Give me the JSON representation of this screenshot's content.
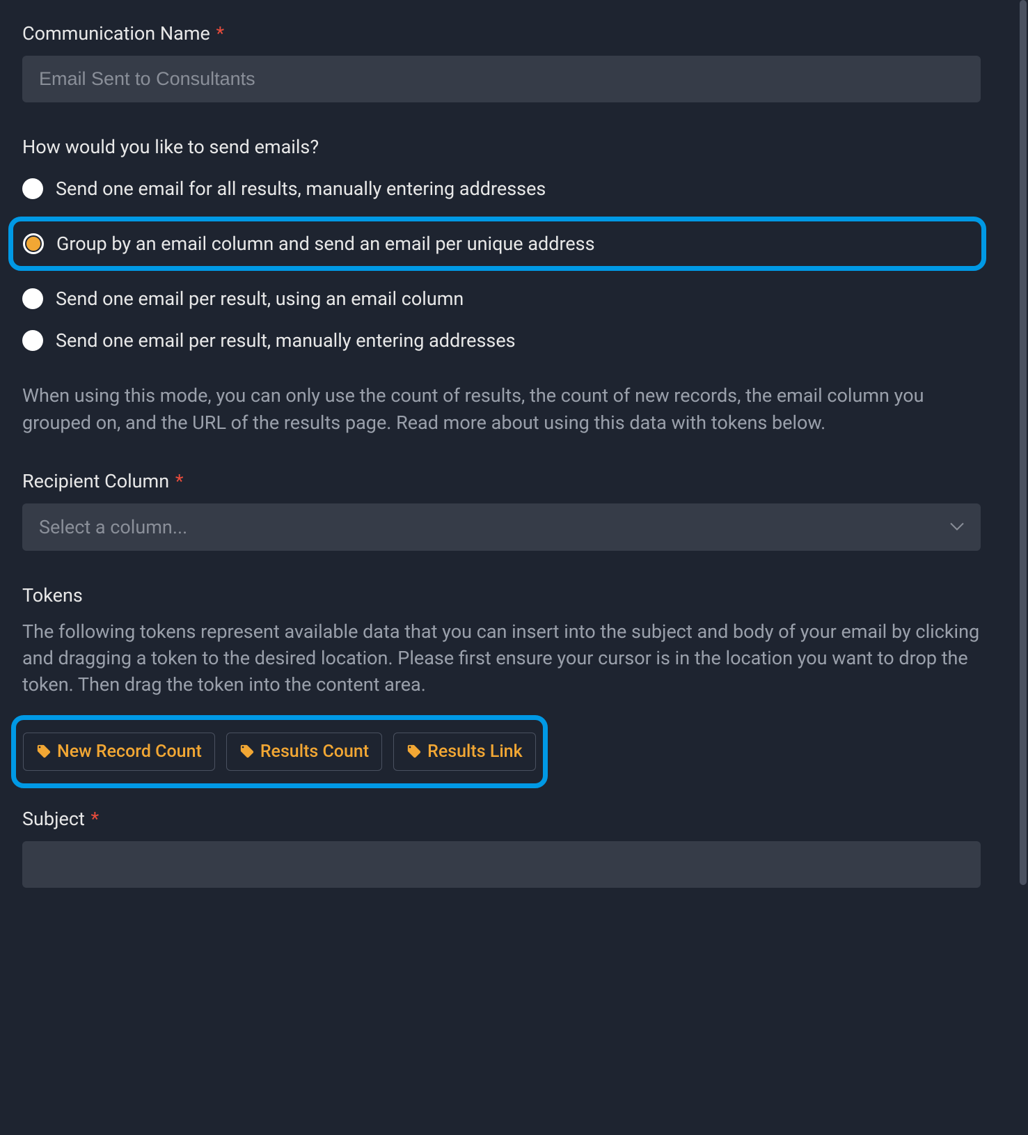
{
  "communication_name": {
    "label": "Communication Name",
    "placeholder": "Email Sent to Consultants",
    "value": ""
  },
  "send_mode": {
    "question": "How would you like to send emails?",
    "options": [
      "Send one email for all results, manually entering addresses",
      "Group by an email column and send an email per unique address",
      "Send one email per result, using an email column",
      "Send one email per result, manually entering addresses"
    ],
    "selected_index": 1,
    "help_text": "When using this mode, you can only use the count of results, the count of new records, the email column you grouped on, and the URL of the results page. Read more about using this data with tokens below."
  },
  "recipient_column": {
    "label": "Recipient Column",
    "placeholder": "Select a column..."
  },
  "tokens": {
    "title": "Tokens",
    "description": "The following tokens represent available data that you can insert into the subject and body of your email by clicking and dragging a token to the desired location. Please first ensure your cursor is in the location you want to drop the token. Then drag the token into the content area.",
    "items": [
      "New Record Count",
      "Results Count",
      "Results Link"
    ]
  },
  "subject": {
    "label": "Subject",
    "value": ""
  }
}
